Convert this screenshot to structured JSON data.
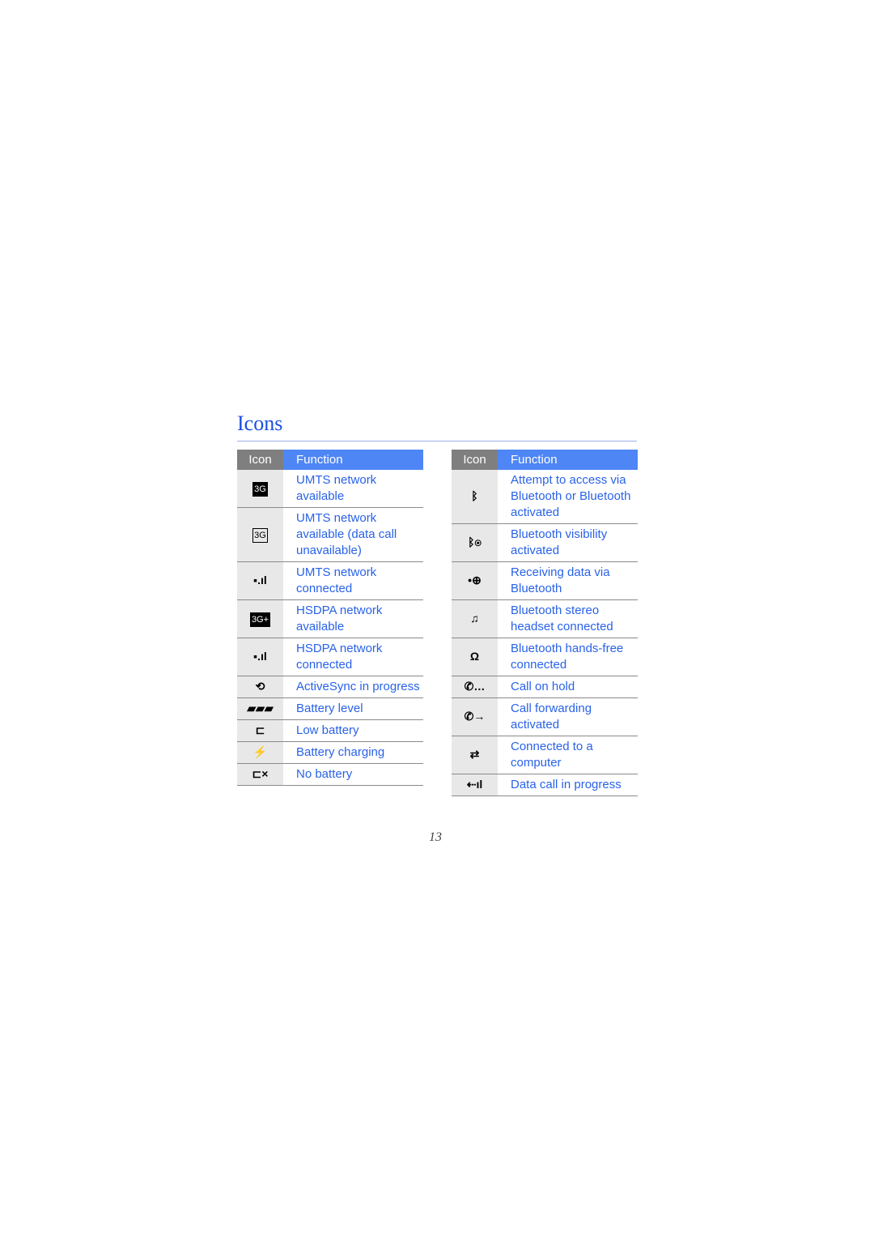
{
  "title": "Icons",
  "page_number": "13",
  "left_table": {
    "headers": {
      "icon": "Icon",
      "function": "Function"
    },
    "rows": [
      {
        "icon": "3G",
        "icon_name": "umts-3g-icon",
        "style": "box3g",
        "function": "UMTS network available"
      },
      {
        "icon": "3G",
        "icon_name": "umts-3g-outline-icon",
        "style": "out3g",
        "function": "UMTS network available (data call unavailable)"
      },
      {
        "icon": "▪.ıl",
        "icon_name": "umts-connected-signal-icon",
        "style": "",
        "function": "UMTS network connected"
      },
      {
        "icon": "3G+",
        "icon_name": "hsdpa-icon",
        "style": "box3g",
        "function": "HSDPA network available"
      },
      {
        "icon": "▪.ıl",
        "icon_name": "hsdpa-connected-signal-icon",
        "style": "",
        "function": "HSDPA network connected"
      },
      {
        "icon": "⟲",
        "icon_name": "activesync-icon",
        "style": "",
        "function": "ActiveSync in progress"
      },
      {
        "icon": "▰▰▰",
        "icon_name": "battery-level-icon",
        "style": "",
        "function": "Battery level"
      },
      {
        "icon": "⊏",
        "icon_name": "low-battery-icon",
        "style": "",
        "function": "Low battery"
      },
      {
        "icon": "⚡",
        "icon_name": "battery-charging-icon",
        "style": "",
        "function": "Battery charging"
      },
      {
        "icon": "⊏×",
        "icon_name": "no-battery-icon",
        "style": "",
        "function": "No battery"
      }
    ]
  },
  "right_table": {
    "headers": {
      "icon": "Icon",
      "function": "Function"
    },
    "rows": [
      {
        "icon": "ᛒ",
        "icon_name": "bluetooth-icon",
        "style": "",
        "function": "Attempt to access via Bluetooth or Bluetooth activated"
      },
      {
        "icon": "ᛒ◉",
        "icon_name": "bluetooth-visibility-icon",
        "style": "",
        "function": "Bluetooth visibility activated"
      },
      {
        "icon": "•⊕",
        "icon_name": "bluetooth-receiving-icon",
        "style": "",
        "function": "Receiving data via Bluetooth"
      },
      {
        "icon": "♫",
        "icon_name": "stereo-headset-icon",
        "style": "",
        "function": "Bluetooth stereo headset connected"
      },
      {
        "icon": "Ω",
        "icon_name": "handsfree-headset-icon",
        "style": "",
        "function": "Bluetooth hands-free connected"
      },
      {
        "icon": "✆…",
        "icon_name": "call-hold-icon",
        "style": "",
        "function": "Call on hold"
      },
      {
        "icon": "✆→",
        "icon_name": "call-forwarding-icon",
        "style": "",
        "function": "Call forwarding activated"
      },
      {
        "icon": "⇄",
        "icon_name": "computer-connected-icon",
        "style": "",
        "function": "Connected to a computer"
      },
      {
        "icon": "⇠ıl",
        "icon_name": "data-call-icon",
        "style": "",
        "function": "Data call in progress"
      }
    ]
  }
}
